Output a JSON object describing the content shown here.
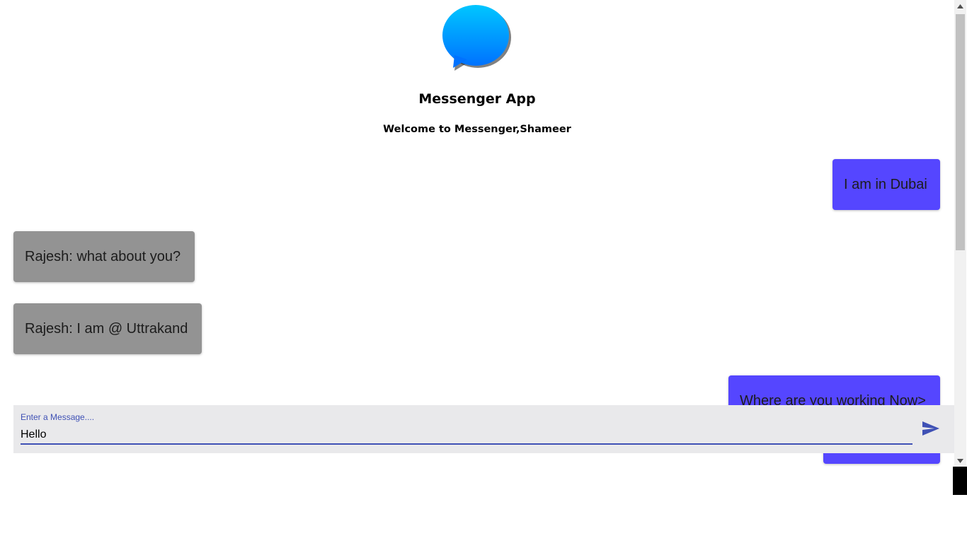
{
  "header": {
    "title": "Messenger App",
    "welcome": "Welcome to Messenger,Shameer",
    "logo_icon": "messenger-bubble-icon"
  },
  "messages": [
    {
      "text": "I am in Dubai",
      "own": true
    },
    {
      "text": "Rajesh: what about you?",
      "own": false
    },
    {
      "text": "Rajesh: I am @ Uttrakand",
      "own": false
    },
    {
      "text": "Where are you working Now>",
      "own": true
    },
    {
      "text": "",
      "own": true
    }
  ],
  "composer": {
    "label": "Enter a Message....",
    "value": "Hello",
    "send_icon": "send-icon"
  },
  "colors": {
    "own_bubble": "#5546ff",
    "other_bubble": "#939393",
    "accent": "#3f51b5",
    "logo_gradient_top": "#00c6ff",
    "logo_gradient_bottom": "#0072ff"
  }
}
